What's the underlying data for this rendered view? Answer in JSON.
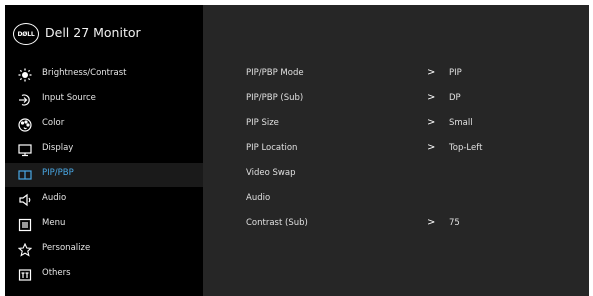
{
  "header": {
    "logo_text": "DØLL",
    "title": "Dell 27 Monitor"
  },
  "sidebar": {
    "items": [
      {
        "label": "Brightness/Contrast",
        "icon": "brightness-icon"
      },
      {
        "label": "Input Source",
        "icon": "input-source-icon"
      },
      {
        "label": "Color",
        "icon": "color-icon"
      },
      {
        "label": "Display",
        "icon": "display-icon"
      },
      {
        "label": "PIP/PBP",
        "icon": "pip-pbp-icon",
        "active": true
      },
      {
        "label": "Audio",
        "icon": "speaker-icon"
      },
      {
        "label": "Menu",
        "icon": "menu-icon"
      },
      {
        "label": "Personalize",
        "icon": "star-icon"
      },
      {
        "label": "Others",
        "icon": "others-icon"
      }
    ]
  },
  "main": {
    "rows": [
      {
        "label": "PIP/PBP Mode",
        "value": "PIP",
        "arrow": ">"
      },
      {
        "label": "PIP/PBP (Sub)",
        "value": "DP",
        "arrow": ">"
      },
      {
        "label": "PIP Size",
        "value": "Small",
        "arrow": ">"
      },
      {
        "label": "PIP Location",
        "value": "Top-Left",
        "arrow": ">"
      },
      {
        "label": "Video Swap",
        "value": "",
        "arrow": ""
      },
      {
        "label": "Audio",
        "value": "",
        "arrow": ""
      },
      {
        "label": "Contrast (Sub)",
        "value": "75",
        "arrow": ">"
      }
    ]
  },
  "colors": {
    "active_accent": "#49a8e6",
    "sidebar_bg": "#000000",
    "panel_bg": "#262626"
  }
}
